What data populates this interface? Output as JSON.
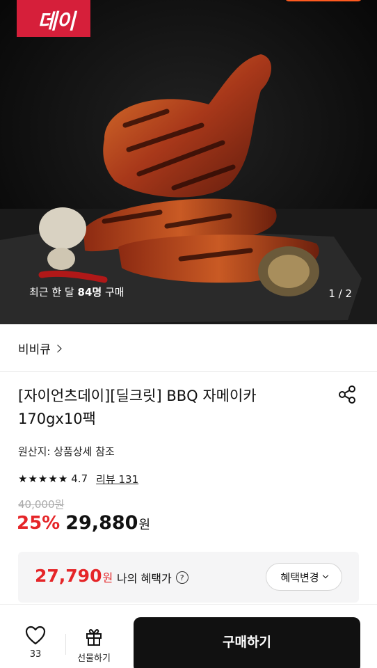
{
  "hero": {
    "brand_badge_text": "데이",
    "recent_prefix": "최근 한 달 ",
    "recent_count": "84명",
    "recent_suffix": " 구매",
    "pager": "1 / 2"
  },
  "brand": {
    "name": "비비큐"
  },
  "product": {
    "title": "[자이언츠데이][딜크릿] BBQ 자메이카 170gx10팩",
    "origin": "원산지: 상품상세 참조",
    "rating": "4.7",
    "review_label": "리뷰 131",
    "original_price": "40,000원",
    "discount_rate": "25%",
    "sale_price": "29,880",
    "currency": "원"
  },
  "benefit": {
    "price": "27,790",
    "currency": "원",
    "label": "나의 혜택가",
    "help_icon_glyph": "?",
    "change_label": "혜택변경"
  },
  "bottom_bar": {
    "wish_count": "33",
    "gift_label": "선물하기",
    "buy_label": "구매하기"
  },
  "colors": {
    "accent_red": "#e52528",
    "badge_red": "#d61f3a",
    "buy_button": "#111111"
  },
  "icons": [
    "share-icon",
    "star-icon",
    "chevron-right-icon",
    "chevron-down-icon",
    "help-icon",
    "heart-icon",
    "gift-icon"
  ]
}
